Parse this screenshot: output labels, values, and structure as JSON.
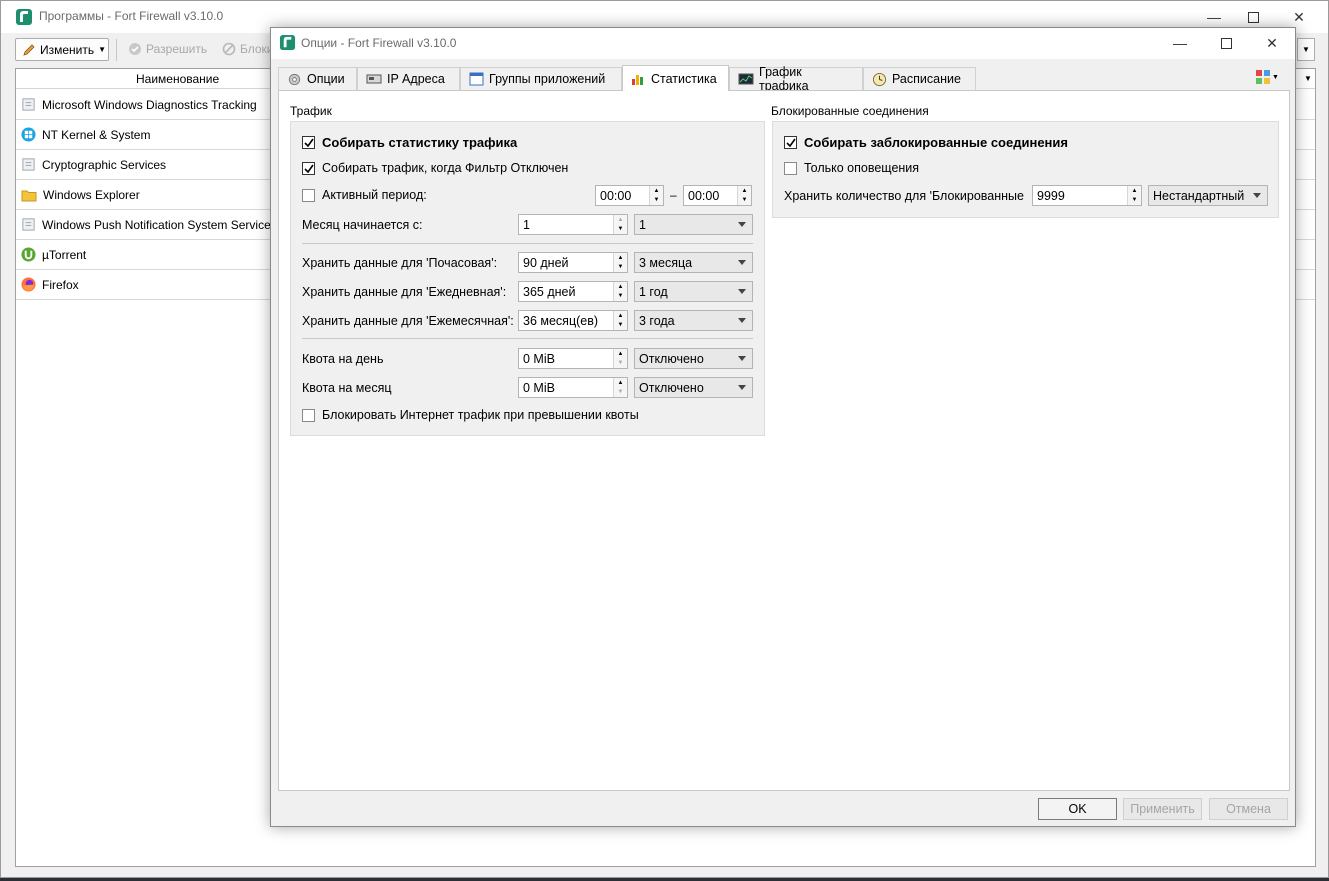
{
  "main_window": {
    "title": "Программы - Fort Firewall v3.10.0",
    "toolbar": {
      "edit_label": "Изменить",
      "allow_label": "Разрешить",
      "block_label": "Блоки"
    },
    "list_header": "Наименование",
    "programs": [
      {
        "name": "Microsoft Windows Diagnostics Tracking",
        "icon": "app-generic-icon"
      },
      {
        "name": "NT Kernel & System",
        "icon": "windows-logo-icon"
      },
      {
        "name": "Cryptographic Services",
        "icon": "app-generic-icon"
      },
      {
        "name": "Windows Explorer",
        "icon": "folder-icon"
      },
      {
        "name": "Windows Push Notification System Service",
        "icon": "app-generic-icon"
      },
      {
        "name": "µTorrent",
        "icon": "utorrent-icon"
      },
      {
        "name": "Firefox",
        "icon": "firefox-icon"
      }
    ]
  },
  "dialog": {
    "title": "Опции - Fort Firewall v3.10.0",
    "tabs": [
      {
        "label": "Опции",
        "icon": "gear-icon"
      },
      {
        "label": "IP Адреса",
        "icon": "network-card-icon"
      },
      {
        "label": "Группы приложений",
        "icon": "app-window-icon"
      },
      {
        "label": "Статистика",
        "icon": "bar-chart-icon"
      },
      {
        "label": "График трафика",
        "icon": "graph-monitor-icon"
      },
      {
        "label": "Расписание",
        "icon": "clock-icon"
      }
    ],
    "active_tab": "Статистика",
    "traffic": {
      "title": "Трафик",
      "collect_stats": {
        "label": "Собирать статистику трафика",
        "checked": true
      },
      "collect_when_off": {
        "label": "Собирать трафик, когда Фильтр Отключен",
        "checked": true
      },
      "active_period": {
        "label": "Активный период:",
        "checked": false,
        "from": "00:00",
        "dash": "–",
        "to": "00:00"
      },
      "month_start": {
        "label": "Месяц начинается с:",
        "value": "1",
        "combo": "1"
      },
      "keep_hourly": {
        "label": "Хранить данные для 'Почасовая':",
        "value": "90 дней",
        "combo": "3 месяца"
      },
      "keep_daily": {
        "label": "Хранить данные для 'Ежедневная':",
        "value": "365 дней",
        "combo": "1 год"
      },
      "keep_monthly": {
        "label": "Хранить данные для 'Ежемесячная':",
        "value": "36 месяц(ев)",
        "combo": "3 года"
      },
      "quota_day": {
        "label": "Квота на день",
        "value": "0 MiB",
        "combo": "Отключено"
      },
      "quota_month": {
        "label": "Квота на месяц",
        "value": "0 MiB",
        "combo": "Отключено"
      },
      "block_on_quota": {
        "label": "Блокировать Интернет трафик при превышении квоты",
        "checked": false
      }
    },
    "blocked": {
      "title": "Блокированные соединения",
      "collect_blocked": {
        "label": "Собирать заблокированные соединения",
        "checked": true
      },
      "only_notify": {
        "label": "Только оповещения",
        "checked": false
      },
      "keep_count": {
        "label": "Хранить количество для 'Блокированные",
        "value": "9999",
        "combo": "Нестандартный"
      }
    },
    "buttons": {
      "ok": "OK",
      "apply": "Применить",
      "cancel": "Отмена"
    }
  }
}
